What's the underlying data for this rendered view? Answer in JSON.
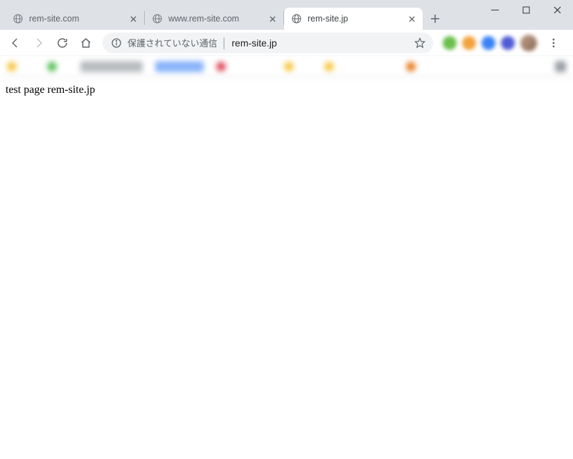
{
  "window": {
    "tabs": [
      {
        "title": "rem-site.com",
        "active": false
      },
      {
        "title": "www.rem-site.com",
        "active": false
      },
      {
        "title": "rem-site.jp",
        "active": true
      }
    ]
  },
  "omnibox": {
    "security_label": "保護されていない通信",
    "url": "rem-site.jp"
  },
  "page": {
    "body_text": "test page rem-site.jp"
  },
  "extensions": {
    "colors": [
      "#6bbf4b",
      "#f2a33c",
      "#3b82f6",
      "#4f5bd5"
    ]
  }
}
